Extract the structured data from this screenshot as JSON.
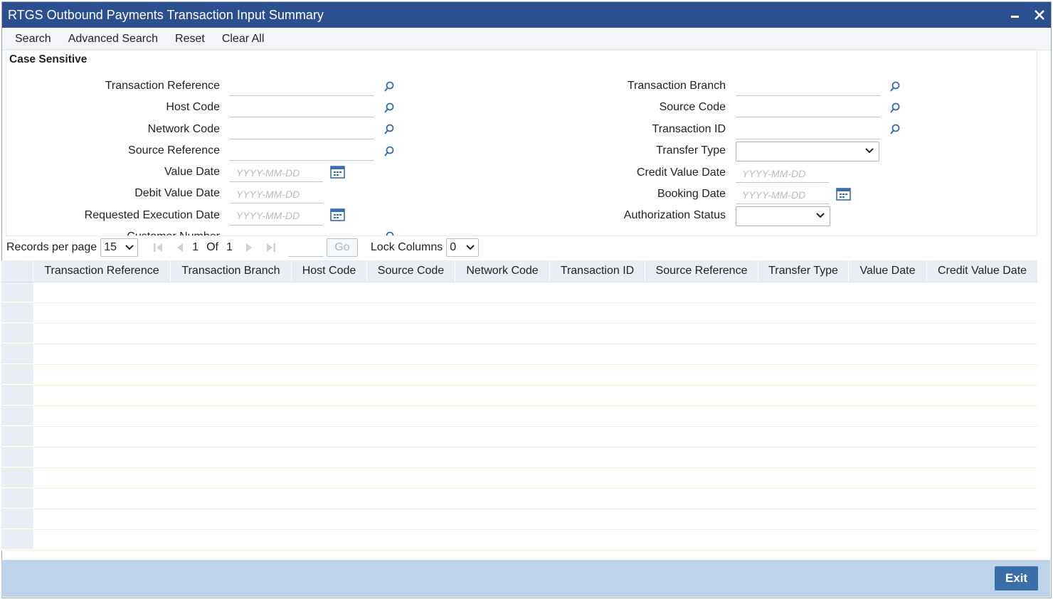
{
  "window": {
    "title": "RTGS Outbound Payments Transaction Input Summary"
  },
  "toolbar": {
    "items": [
      "Search",
      "Advanced Search",
      "Reset",
      "Clear All"
    ]
  },
  "form": {
    "section_label": "Case Sensitive",
    "left_fields": {
      "transaction_reference": "Transaction Reference",
      "host_code": "Host Code",
      "network_code": "Network Code",
      "source_reference": "Source Reference",
      "value_date": "Value Date",
      "debit_value_date": "Debit Value Date",
      "requested_execution_date": "Requested Execution Date",
      "customer_number": "Customer Number"
    },
    "right_fields": {
      "transaction_branch": "Transaction Branch",
      "source_code": "Source Code",
      "transaction_id": "Transaction ID",
      "transfer_type": "Transfer Type",
      "credit_value_date": "Credit Value Date",
      "booking_date": "Booking Date",
      "authorization_status": "Authorization Status"
    },
    "date_placeholder": "YYYY-MM-DD"
  },
  "pager": {
    "records_per_page_label": "Records per page",
    "records_per_page_value": "15",
    "current_page": "1",
    "of_label": "Of",
    "total_pages": "1",
    "go_label": "Go",
    "lock_columns_label": "Lock Columns",
    "lock_columns_value": "0"
  },
  "grid": {
    "columns": [
      "Transaction Reference",
      "Transaction Branch",
      "Host Code",
      "Source Code",
      "Network Code",
      "Transaction ID",
      "Source Reference",
      "Transfer Type",
      "Value Date",
      "Credit Value Date"
    ],
    "row_count": 13
  },
  "footer": {
    "exit_label": "Exit"
  },
  "colors": {
    "titlebar": "#2c4f8f",
    "footer": "#bcd3ea",
    "exit_button": "#3a6ea8",
    "icon_blue": "#3a6ea8"
  },
  "icons": {
    "search": "search-icon",
    "calendar": "calendar-icon",
    "minimize": "minimize-icon",
    "close": "close-icon"
  }
}
